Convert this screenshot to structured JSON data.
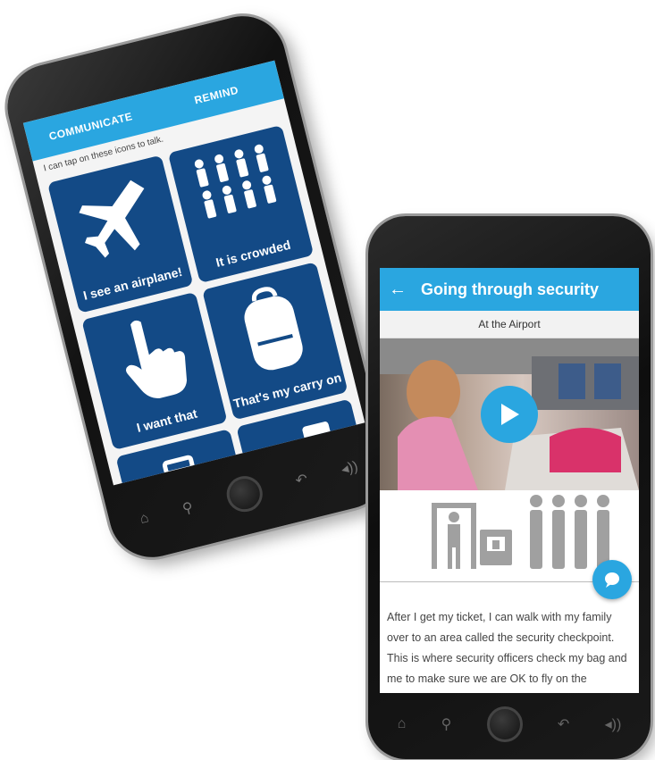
{
  "phone1": {
    "tabs": [
      "COMMUNICATE",
      "REMIND"
    ],
    "hint": "I can tap on these icons to talk.",
    "tiles": [
      {
        "label": "I see an airplane!",
        "icon": "airplane-icon"
      },
      {
        "label": "It is crowded",
        "icon": "crowd-icon"
      },
      {
        "label": "I want that",
        "icon": "pointing-hand-icon"
      },
      {
        "label": "That's my carry on",
        "icon": "backpack-icon"
      },
      {
        "label": "",
        "icon": "suitcase-icon"
      },
      {
        "label": "",
        "icon": "toilet-icon"
      }
    ],
    "nav_icons": [
      "home-icon",
      "search-icon",
      "home-button",
      "back-icon",
      "volume-icon"
    ]
  },
  "phone2": {
    "title": "Going through security",
    "subtitle": "At the Airport",
    "body_text": "After I get my ticket, I can walk with my family over to an area called the security checkpoint. This is where security officers check my bag and me to make sure we are OK to fly on the airplane.",
    "colors": {
      "accent": "#2aa6e0",
      "tile": "#134a86"
    }
  }
}
